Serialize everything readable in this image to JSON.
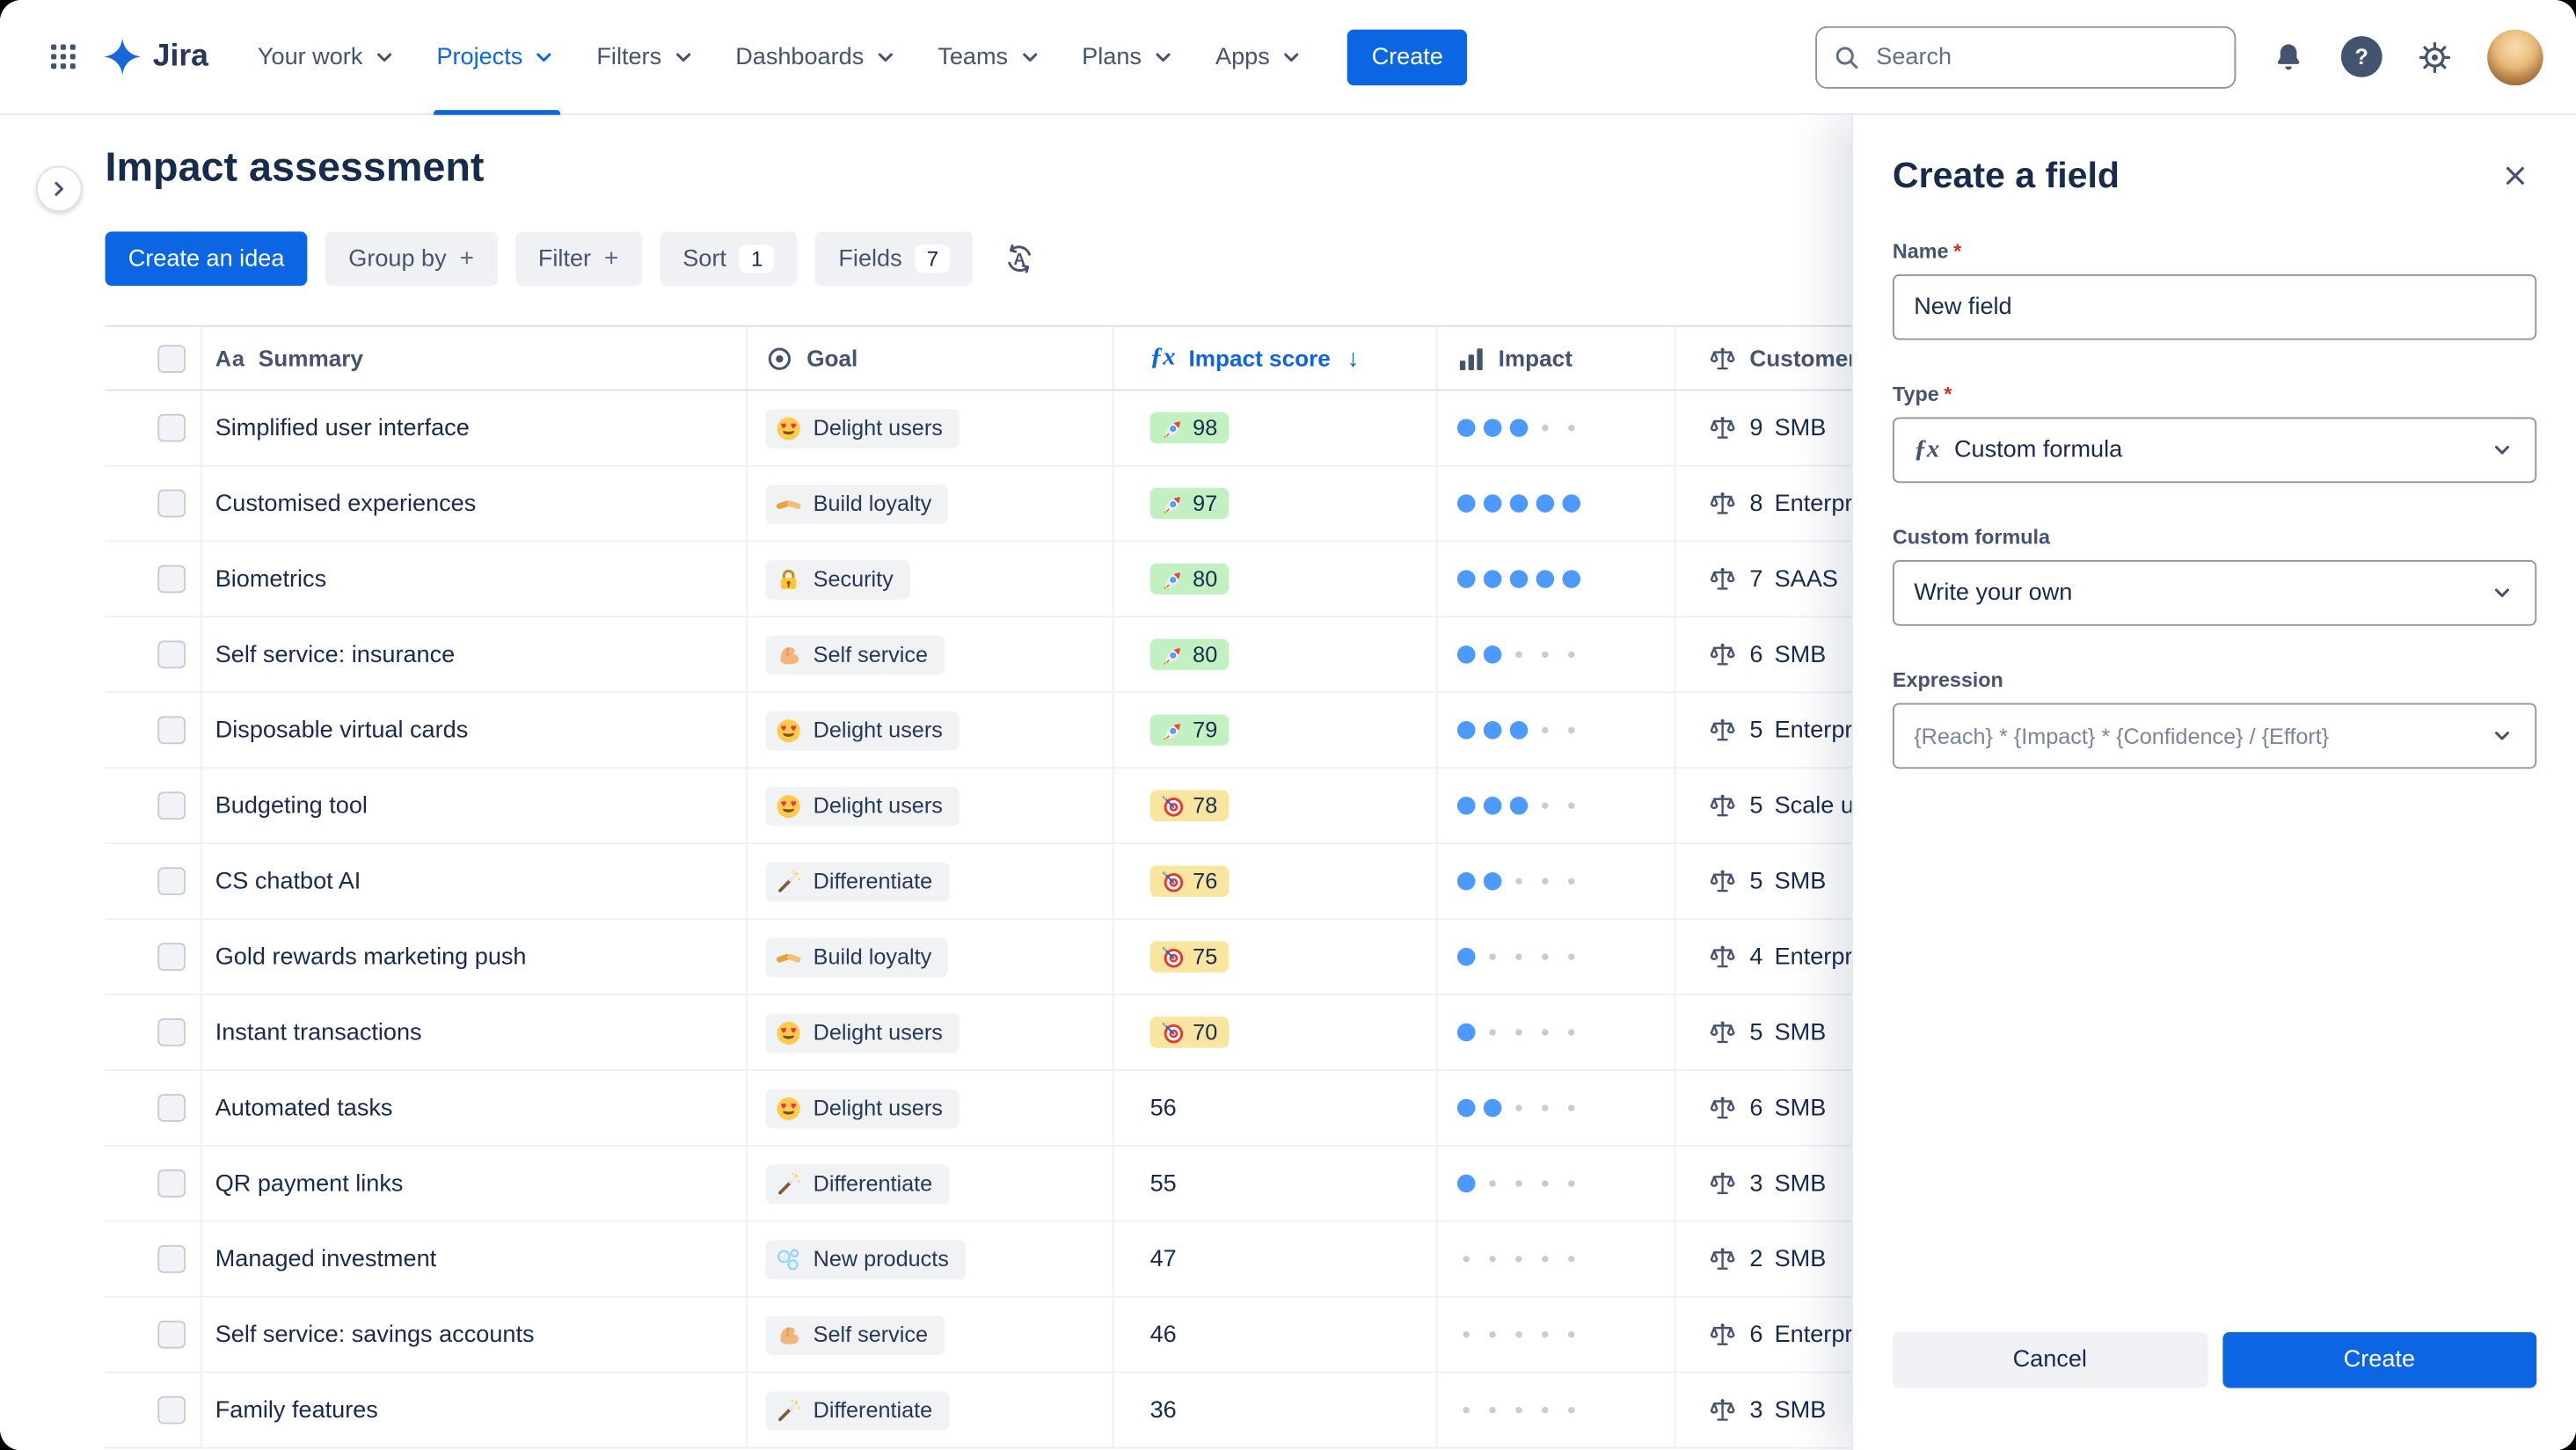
{
  "colors": {
    "accent_blue": "#0C66E4",
    "text_dark": "#172B4D",
    "text_subtle": "#44546F",
    "score_green": "#C3F0C0",
    "score_yellow": "#F8E6A0",
    "impact_dot_blue": "#4C9AFF"
  },
  "navbar": {
    "logo_text": "Jira",
    "help_glyph": "?",
    "items": [
      {
        "label": "Your work",
        "active": false
      },
      {
        "label": "Projects",
        "active": true
      },
      {
        "label": "Filters",
        "active": false
      },
      {
        "label": "Dashboards",
        "active": false
      },
      {
        "label": "Teams",
        "active": false
      },
      {
        "label": "Plans",
        "active": false
      },
      {
        "label": "Apps",
        "active": false
      }
    ],
    "create_button": "Create",
    "search_placeholder": "Search"
  },
  "page": {
    "title": "Impact assessment"
  },
  "toolbar": {
    "create_idea": "Create an idea",
    "group_by": "Group by",
    "filter": "Filter",
    "plus": "+",
    "sort": "Sort",
    "sort_count": "1",
    "fields": "Fields",
    "fields_count": "7"
  },
  "table": {
    "headers": {
      "summary_icon": "Aa",
      "summary": "Summary",
      "goal": "Goal",
      "impact_score_fx": "ƒx",
      "impact_score": "Impact score",
      "impact_score_sort": "↓",
      "impact": "Impact",
      "customer": "Customer"
    },
    "rows": [
      {
        "summary": "Simplified user interface",
        "goal": {
          "icon": "heart-eyes",
          "label": "Delight users"
        },
        "score": {
          "value": "98",
          "tone": "green",
          "icon": "rocket"
        },
        "impact": 3,
        "customer": {
          "value": "9",
          "label": "SMB"
        }
      },
      {
        "summary": "Customised experiences",
        "goal": {
          "icon": "handshake",
          "label": "Build loyalty"
        },
        "score": {
          "value": "97",
          "tone": "green",
          "icon": "rocket"
        },
        "impact": 5,
        "customer": {
          "value": "8",
          "label": "Enterprise"
        }
      },
      {
        "summary": "Biometrics",
        "goal": {
          "icon": "lock",
          "label": "Security"
        },
        "score": {
          "value": "80",
          "tone": "green",
          "icon": "rocket"
        },
        "impact": 5,
        "customer": {
          "value": "7",
          "label": "SAAS"
        }
      },
      {
        "summary": "Self service: insurance",
        "goal": {
          "icon": "muscle",
          "label": "Self service"
        },
        "score": {
          "value": "80",
          "tone": "green",
          "icon": "rocket"
        },
        "impact": 2,
        "customer": {
          "value": "6",
          "label": "SMB"
        }
      },
      {
        "summary": "Disposable virtual cards",
        "goal": {
          "icon": "heart-eyes",
          "label": "Delight users"
        },
        "score": {
          "value": "79",
          "tone": "green",
          "icon": "rocket"
        },
        "impact": 3,
        "customer": {
          "value": "5",
          "label": "Enterprise"
        }
      },
      {
        "summary": "Budgeting tool",
        "goal": {
          "icon": "heart-eyes",
          "label": "Delight users"
        },
        "score": {
          "value": "78",
          "tone": "yellow",
          "icon": "dart"
        },
        "impact": 3,
        "customer": {
          "value": "5",
          "label": "Scale ups"
        }
      },
      {
        "summary": "CS chatbot AI",
        "goal": {
          "icon": "wand",
          "label": "Differentiate"
        },
        "score": {
          "value": "76",
          "tone": "yellow",
          "icon": "dart"
        },
        "impact": 2,
        "customer": {
          "value": "5",
          "label": "SMB"
        }
      },
      {
        "summary": "Gold rewards marketing push",
        "goal": {
          "icon": "handshake",
          "label": "Build loyalty"
        },
        "score": {
          "value": "75",
          "tone": "yellow",
          "icon": "dart"
        },
        "impact": 1,
        "customer": {
          "value": "4",
          "label": "Enterprise"
        }
      },
      {
        "summary": "Instant transactions",
        "goal": {
          "icon": "heart-eyes",
          "label": "Delight users"
        },
        "score": {
          "value": "70",
          "tone": "yellow",
          "icon": "dart"
        },
        "impact": 1,
        "customer": {
          "value": "5",
          "label": "SMB"
        }
      },
      {
        "summary": "Automated tasks",
        "goal": {
          "icon": "heart-eyes",
          "label": "Delight users"
        },
        "score": {
          "value": "56",
          "tone": "plain",
          "icon": null
        },
        "impact": 2,
        "customer": {
          "value": "6",
          "label": "SMB"
        }
      },
      {
        "summary": "QR payment links",
        "goal": {
          "icon": "wand",
          "label": "Differentiate"
        },
        "score": {
          "value": "55",
          "tone": "plain",
          "icon": null
        },
        "impact": 1,
        "customer": {
          "value": "3",
          "label": "SMB"
        }
      },
      {
        "summary": "Managed investment",
        "goal": {
          "icon": "bubbles",
          "label": "New products"
        },
        "score": {
          "value": "47",
          "tone": "plain",
          "icon": null
        },
        "impact": 0,
        "customer": {
          "value": "2",
          "label": "SMB"
        }
      },
      {
        "summary": "Self service: savings accounts",
        "goal": {
          "icon": "muscle",
          "label": "Self service"
        },
        "score": {
          "value": "46",
          "tone": "plain",
          "icon": null
        },
        "impact": 0,
        "customer": {
          "value": "6",
          "label": "Enterprise"
        }
      },
      {
        "summary": "Family features",
        "goal": {
          "icon": "wand",
          "label": "Differentiate"
        },
        "score": {
          "value": "36",
          "tone": "plain",
          "icon": null
        },
        "impact": 0,
        "customer": {
          "value": "3",
          "label": "SMB"
        }
      }
    ]
  },
  "panel": {
    "title": "Create a field",
    "name": {
      "label": "Name",
      "required": "*",
      "value": "New field"
    },
    "type": {
      "label": "Type",
      "required": "*",
      "icon": "ƒx",
      "value": "Custom formula"
    },
    "custom_formula": {
      "label": "Custom formula",
      "value": "Write your own"
    },
    "expression": {
      "label": "Expression",
      "value": "{Reach} * {Impact} * {Confidence} / {Effort}"
    },
    "cancel": "Cancel",
    "create": "Create"
  }
}
